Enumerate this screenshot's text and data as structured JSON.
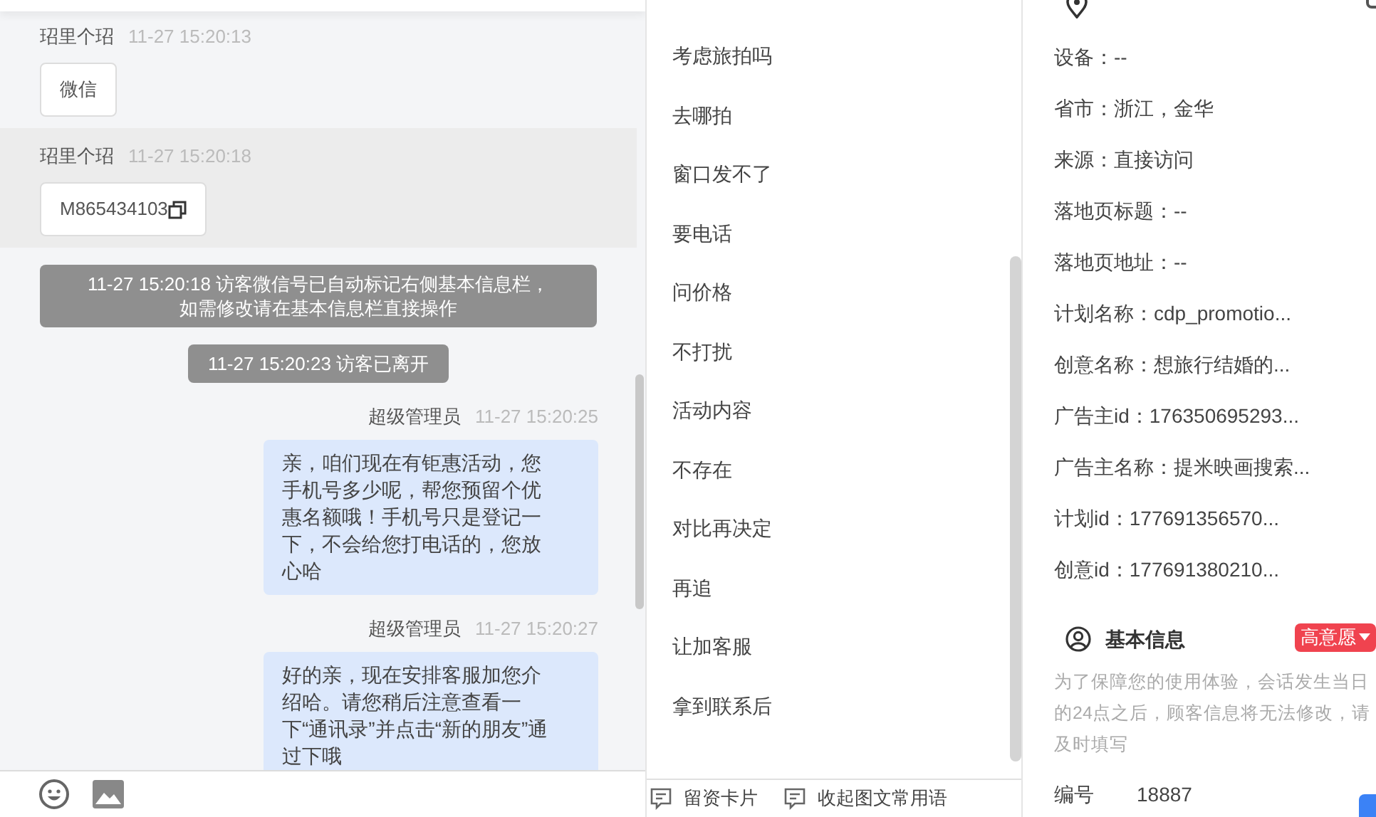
{
  "chat": {
    "messages": [
      {
        "kind": "visitor",
        "sender": "玿里个玿",
        "time": "11-27 15:20:13",
        "text": "微信",
        "highlighted": false,
        "copyable": false
      },
      {
        "kind": "visitor",
        "sender": "玿里个玿",
        "time": "11-27 15:20:18",
        "text": "M865434103",
        "highlighted": true,
        "copyable": true
      },
      {
        "kind": "notice",
        "lines": [
          "11-27 15:20:18 访客微信号已自动标记右侧基本信息栏，",
          "如需修改请在基本信息栏直接操作"
        ]
      },
      {
        "kind": "notice",
        "lines": [
          "11-27 15:20:23 访客已离开"
        ]
      },
      {
        "kind": "agent",
        "sender": "超级管理员",
        "time": "11-27 15:20:25",
        "text": "亲，咱们现在有钜惠活动，您手机号多少呢，帮您预留个优惠名额哦！手机号只是登记一下，不会给您打电话的，您放心哈"
      },
      {
        "kind": "agent",
        "sender": "超级管理员",
        "time": "11-27 15:20:27",
        "text": "好的亲，现在安排客服加您介绍哈。请您稍后注意查看一下“通讯录”并点击“新的朋友”通过下哦"
      }
    ]
  },
  "quick_replies": {
    "items": [
      "考虑旅拍吗",
      "去哪拍",
      "窗口发不了",
      "要电话",
      "问价格",
      "不打扰",
      "活动内容",
      "不存在",
      "对比再决定",
      "再追",
      "让加客服",
      "拿到联系后"
    ],
    "buttons": [
      "留资卡片",
      "收起图文常用语"
    ]
  },
  "source_info": {
    "fields": [
      "设备：--",
      "省市：浙江，金华",
      "来源：直接访问",
      "落地页标题：--",
      "落地页地址：--",
      "计划名称：cdp_promotio...",
      "创意名称：想旅行结婚的...",
      "广告主id：176350695293...",
      "广告主名称：提米映画搜索...",
      "计划id：177691356570...",
      "创意id：177691380210..."
    ]
  },
  "basic_info": {
    "title": "基本信息",
    "intent_tag": "高意愿",
    "note": "为了保障您的使用体验，会话发生当日的24点之后，顾客信息将无法修改，请及时填写",
    "fields": [
      {
        "label": "编号",
        "value": "18887"
      }
    ]
  }
}
